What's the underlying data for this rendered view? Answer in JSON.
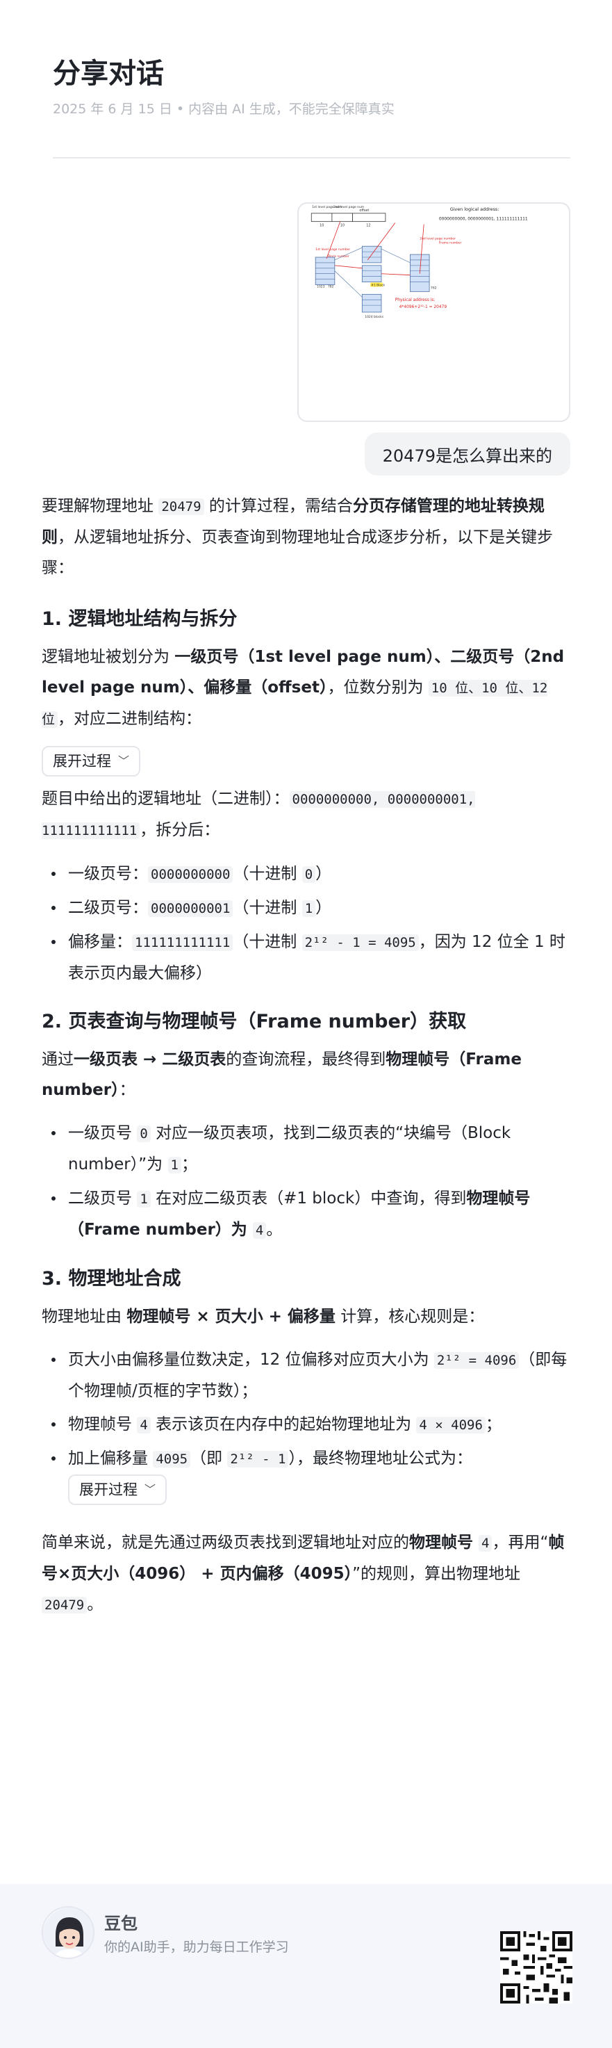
{
  "header": {
    "title": "分享对话",
    "subtitle": "2025 年 6 月 15 日 • 内容由 AI 生成，不能完全保障真实"
  },
  "image": {
    "col1": "1st level page num",
    "col2": "2nd level page num",
    "col3": "offset",
    "bits": [
      "10",
      "10",
      "12"
    ],
    "given_label": "Given logical address:",
    "given_value": "0000000000, 0000000001, 111111111111",
    "first_table_label": "1st level page number",
    "block_label": "Block number",
    "second_label": "2nd level page number",
    "frame_label": "Frame number",
    "n1023": "1023",
    "n782": "782",
    "n762": "762",
    "n1024": "1024",
    "block_tag": "#1 Block",
    "blocks_label": "1024 blocks",
    "phys1": "Physical address is:",
    "phys2": "4*4096+2¹²-1 = 20479"
  },
  "query": "20479是怎么算出来的",
  "answer": {
    "intro_pre": "要理解物理地址 ",
    "intro_code": "20479",
    "intro_mid": " 的计算过程，需结合",
    "intro_bold": "分页存储管理的地址转换规则",
    "intro_post": "，从逻辑地址拆分、页表查询到物理地址合成逐步分析，以下是关键步骤：",
    "s1_title": "1. 逻辑地址结构与拆分",
    "s1_p1_pre": "逻辑地址被划分为 ",
    "s1_p1_b": "一级页号（1st level page num）、二级页号（2nd level page num）、偏移量（offset）",
    "s1_p1_mid": "，位数分别为 ",
    "s1_p1_c1": "10 位、10 位、12 位",
    "s1_p1_post": "，对应二进制结构：",
    "expand1": "展开过程",
    "s1_p2_pre": "题目中给出的逻辑地址（二进制）：",
    "s1_p2_code": "0000000000, 0000000001, 111111111111",
    "s1_p2_post": "，拆分后：",
    "s1_li1_pre": "一级页号：",
    "s1_li1_code": "0000000000",
    "s1_li1_mid": "（十进制 ",
    "s1_li1_c2": "0",
    "s1_li1_post": "）",
    "s1_li2_pre": "二级页号：",
    "s1_li2_code": "0000000001",
    "s1_li2_mid": "（十进制 ",
    "s1_li2_c2": "1",
    "s1_li2_post": "）",
    "s1_li3_pre": "偏移量：",
    "s1_li3_code": "111111111111",
    "s1_li3_mid": "（十进制 ",
    "s1_li3_c2": "2¹² - 1 = 4095",
    "s1_li3_post": "，因为 12 位全 1 时表示页内最大偏移）",
    "s2_title": "2. 页表查询与物理帧号（Frame number）获取",
    "s2_p_pre": "通过",
    "s2_p_b1": "一级页表 → 二级页表",
    "s2_p_mid": "的查询流程，最终得到",
    "s2_p_b2": "物理帧号（Frame number）",
    "s2_p_post": "：",
    "s2_li1_pre": "一级页号 ",
    "s2_li1_code": "0",
    "s2_li1_mid": " 对应一级页表项，找到二级页表的“块编号（Block number）”为 ",
    "s2_li1_c2": "1",
    "s2_li1_post": "；",
    "s2_li2_pre": "二级页号 ",
    "s2_li2_code": "1",
    "s2_li2_mid": " 在对应二级页表（#1 block）中查询，得到",
    "s2_li2_b": "物理帧号（Frame number）为 ",
    "s2_li2_c2": "4",
    "s2_li2_post": "。",
    "s3_title": "3. 物理地址合成",
    "s3_p_pre": "物理地址由 ",
    "s3_p_b": "物理帧号 × 页大小 + 偏移量",
    "s3_p_post": " 计算，核心规则是：",
    "s3_li1_pre": "页大小由偏移量位数决定，12 位偏移对应页大小为 ",
    "s3_li1_code": "2¹² = 4096",
    "s3_li1_post": "（即每个物理帧/页框的字节数）；",
    "s3_li2_pre": "物理帧号 ",
    "s3_li2_code": "4",
    "s3_li2_mid": " 表示该页在内存中的起始物理地址为 ",
    "s3_li2_c2": "4 × 4096",
    "s3_li2_post": "；",
    "s3_li3_pre": "加上偏移量 ",
    "s3_li3_code": "4095",
    "s3_li3_mid": "（即 ",
    "s3_li3_c2": "2¹² - 1",
    "s3_li3_post": "），最终物理地址公式为：",
    "expand2": "展开过程",
    "sum_pre": "简单来说，就是先通过两级页表找到逻辑地址对应的",
    "sum_b1": "物理帧号 ",
    "sum_c1": "4",
    "sum_mid": "，再用“",
    "sum_b2": "帧号×页大小（4096） + 页内偏移（4095）",
    "sum_mid2": "”的规则，算出物理地址 ",
    "sum_c2": "20479",
    "sum_post": "。"
  },
  "footer": {
    "bot_name": "豆包",
    "bot_desc": "你的AI助手，助力每日工作学习"
  }
}
